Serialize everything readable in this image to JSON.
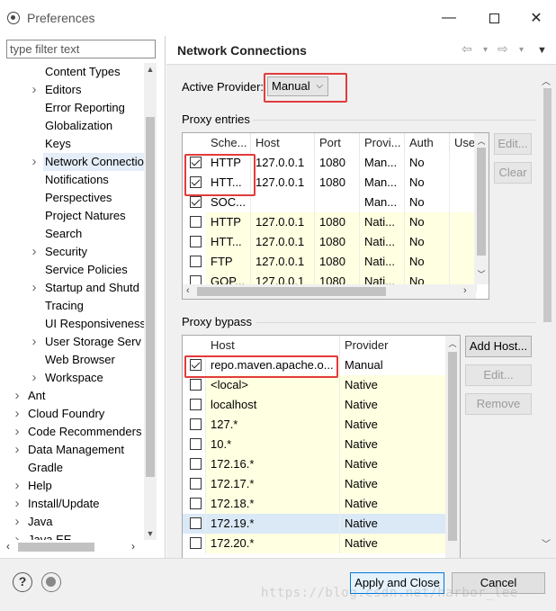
{
  "window": {
    "title": "Preferences",
    "minimize_glyph": "—",
    "close_glyph": "✕"
  },
  "filter": {
    "placeholder": "type filter text"
  },
  "tree": {
    "items": [
      {
        "label": "Content Types",
        "level": 2,
        "chevron": false
      },
      {
        "label": "Editors",
        "level": 2,
        "chevron": true
      },
      {
        "label": "Error Reporting",
        "level": 2,
        "chevron": false
      },
      {
        "label": "Globalization",
        "level": 2,
        "chevron": false
      },
      {
        "label": "Keys",
        "level": 2,
        "chevron": false
      },
      {
        "label": "Network Connectio",
        "level": 2,
        "chevron": true,
        "selected": true
      },
      {
        "label": "Notifications",
        "level": 2,
        "chevron": false
      },
      {
        "label": "Perspectives",
        "level": 2,
        "chevron": false
      },
      {
        "label": "Project Natures",
        "level": 2,
        "chevron": false
      },
      {
        "label": "Search",
        "level": 2,
        "chevron": false
      },
      {
        "label": "Security",
        "level": 2,
        "chevron": true
      },
      {
        "label": "Service Policies",
        "level": 2,
        "chevron": false
      },
      {
        "label": "Startup and Shutd",
        "level": 2,
        "chevron": true
      },
      {
        "label": "Tracing",
        "level": 2,
        "chevron": false
      },
      {
        "label": "UI Responsiveness",
        "level": 2,
        "chevron": false
      },
      {
        "label": "User Storage Serv",
        "level": 2,
        "chevron": true
      },
      {
        "label": "Web Browser",
        "level": 2,
        "chevron": false
      },
      {
        "label": "Workspace",
        "level": 2,
        "chevron": true
      },
      {
        "label": "Ant",
        "level": 1,
        "chevron": true
      },
      {
        "label": "Cloud Foundry",
        "level": 1,
        "chevron": true
      },
      {
        "label": "Code Recommenders",
        "level": 1,
        "chevron": true
      },
      {
        "label": "Data Management",
        "level": 1,
        "chevron": true
      },
      {
        "label": "Gradle",
        "level": 1,
        "chevron": false
      },
      {
        "label": "Help",
        "level": 1,
        "chevron": true
      },
      {
        "label": "Install/Update",
        "level": 1,
        "chevron": true
      },
      {
        "label": "Java",
        "level": 1,
        "chevron": true
      },
      {
        "label": "Java EE",
        "level": 1,
        "chevron": true
      }
    ]
  },
  "page": {
    "title": "Network Connections",
    "nav": {
      "back": "⇦",
      "forward": "⇨",
      "dropdown": "▾",
      "menu": "▼"
    }
  },
  "provider": {
    "label": "Active Provider:",
    "value": "Manual"
  },
  "proxy_entries": {
    "label": "Proxy entries",
    "columns": [
      "Sche...",
      "Host",
      "Port",
      "Provi...",
      "Auth",
      "Use"
    ],
    "rows": [
      {
        "checked": true,
        "scheme": "HTTP",
        "host": "127.0.0.1",
        "port": "1080",
        "provider": "Man...",
        "auth": "No",
        "yellow": false
      },
      {
        "checked": true,
        "scheme": "HTT...",
        "host": "127.0.0.1",
        "port": "1080",
        "provider": "Man...",
        "auth": "No",
        "yellow": false
      },
      {
        "checked": true,
        "scheme": "SOC...",
        "host": "",
        "port": "",
        "provider": "Man...",
        "auth": "No",
        "yellow": false
      },
      {
        "checked": false,
        "scheme": "HTTP",
        "host": "127.0.0.1",
        "port": "1080",
        "provider": "Nati...",
        "auth": "No",
        "yellow": true
      },
      {
        "checked": false,
        "scheme": "HTT...",
        "host": "127.0.0.1",
        "port": "1080",
        "provider": "Nati...",
        "auth": "No",
        "yellow": true
      },
      {
        "checked": false,
        "scheme": "FTP",
        "host": "127.0.0.1",
        "port": "1080",
        "provider": "Nati...",
        "auth": "No",
        "yellow": true
      },
      {
        "checked": false,
        "scheme": "GOP...",
        "host": "127.0.0.1",
        "port": "1080",
        "provider": "Nati...",
        "auth": "No",
        "yellow": true
      }
    ],
    "buttons": {
      "edit": "Edit...",
      "clear": "Clear"
    }
  },
  "proxy_bypass": {
    "label": "Proxy bypass",
    "columns": [
      "Host",
      "Provider"
    ],
    "rows": [
      {
        "checked": true,
        "host": "repo.maven.apache.o...",
        "provider": "Manual",
        "yellow": false
      },
      {
        "checked": false,
        "host": "<local>",
        "provider": "Native",
        "yellow": true
      },
      {
        "checked": false,
        "host": "localhost",
        "provider": "Native",
        "yellow": true
      },
      {
        "checked": false,
        "host": "127.*",
        "provider": "Native",
        "yellow": true
      },
      {
        "checked": false,
        "host": "10.*",
        "provider": "Native",
        "yellow": true
      },
      {
        "checked": false,
        "host": "172.16.*",
        "provider": "Native",
        "yellow": true
      },
      {
        "checked": false,
        "host": "172.17.*",
        "provider": "Native",
        "yellow": true
      },
      {
        "checked": false,
        "host": "172.18.*",
        "provider": "Native",
        "yellow": true
      },
      {
        "checked": false,
        "host": "172.19.*",
        "provider": "Native",
        "yellow": true,
        "highlight": true
      },
      {
        "checked": false,
        "host": "172.20.*",
        "provider": "Native",
        "yellow": true
      }
    ],
    "buttons": {
      "add_host": "Add Host...",
      "edit": "Edit...",
      "remove": "Remove"
    }
  },
  "footer": {
    "help_glyph": "?",
    "apply_close": "Apply and Close",
    "cancel": "Cancel",
    "watermark": "https://blog.csdn.net/harbor_lee"
  },
  "colors": {
    "annotation_red": "#e23b3b",
    "native_row_yellow": "#ffffe1",
    "selection_blue": "#dbe9f7",
    "primary_border": "#0078d7"
  }
}
